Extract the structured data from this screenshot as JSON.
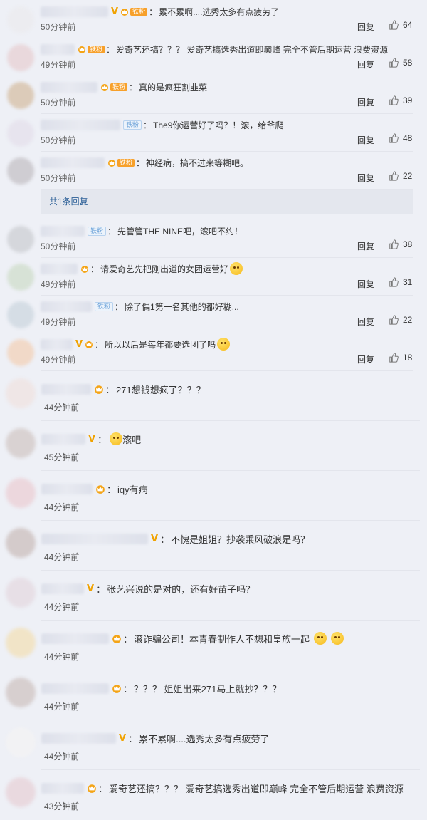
{
  "comments": [
    {
      "badge": "v",
      "fan": "orange",
      "fan_label": "铁粉",
      "text": "累不累啊....选秀太多有点疲劳了",
      "time": "50分钟前",
      "reply": "回复",
      "likes": "64",
      "avatar": "#ececf0",
      "emoji": 0
    },
    {
      "badge": "",
      "fan": "orange",
      "fan_label": "铁粉",
      "text": "爱奇艺还搞？？？ 爱奇艺搞选秀出道即巅峰 完全不管后期运营 浪费资源",
      "time": "49分钟前",
      "reply": "回复",
      "likes": "58",
      "avatar": "#e9d8dc",
      "emoji": 0
    },
    {
      "badge": "",
      "fan": "orange",
      "fan_label": "铁粉",
      "text": "真的是疯狂割韭菜",
      "time": "50分钟前",
      "reply": "回复",
      "likes": "39",
      "avatar": "#dccbb9",
      "emoji": 0
    },
    {
      "badge": "",
      "fan": "blue",
      "fan_label": "铁粉",
      "text": "The9你运营好了吗？！滚，给爷爬",
      "time": "50分钟前",
      "reply": "回复",
      "likes": "48",
      "avatar": "#e7e4ee",
      "emoji": 0
    },
    {
      "badge": "",
      "fan": "orange",
      "fan_label": "铁粉",
      "text": "神经病，搞不过来等糊吧。",
      "time": "50分钟前",
      "reply": "回复",
      "likes": "22",
      "avatar": "#cfcdd2",
      "emoji": 0
    },
    {
      "badge": "",
      "fan": "blue",
      "fan_label": "铁粉",
      "text": "先管管THE NINE吧，滚吧不约！",
      "time": "50分钟前",
      "reply": "回复",
      "likes": "38",
      "avatar": "#d5d7dc",
      "emoji": 0
    },
    {
      "badge": "",
      "fan": "crown",
      "fan_label": "",
      "text": "请爱奇艺先把刚出道的女团运营好",
      "time": "49分钟前",
      "reply": "回复",
      "likes": "31",
      "avatar": "#d7e2d6",
      "emoji": 1
    },
    {
      "badge": "",
      "fan": "blue",
      "fan_label": "铁粉",
      "text": "除了偶1第一名其他的都好糊...",
      "time": "49分钟前",
      "reply": "回复",
      "likes": "22",
      "avatar": "#d5dde5",
      "emoji": 0
    },
    {
      "badge": "v",
      "fan": "crown",
      "fan_label": "",
      "text": "所以以后是每年都要选团了吗",
      "time": "49分钟前",
      "reply": "回复",
      "likes": "18",
      "avatar": "#f1d9c8",
      "emoji": 1
    }
  ],
  "more_replies": "共1条回复",
  "large_comments": [
    {
      "badge": "",
      "text": "271想钱想疯了？？？",
      "time": "44分钟前",
      "avatar": "#efe6e6",
      "emoji": 0,
      "emoji_before": 0
    },
    {
      "badge": "v",
      "text": "滚吧",
      "time": "45分钟前",
      "avatar": "#d9d2d2",
      "emoji": 0,
      "emoji_before": 1
    },
    {
      "badge": "",
      "text": "iqy有病",
      "time": "44分钟前",
      "avatar": "#ecd7dd",
      "emoji": 0,
      "emoji_before": 0
    },
    {
      "badge": "v",
      "text": "不愧是姐姐？抄袭乘风破浪是吗？",
      "time": "44分钟前",
      "avatar": "#d4cbcb",
      "emoji": 0,
      "emoji_before": 0
    },
    {
      "badge": "v",
      "text": "张艺兴说的是对的，还有好苗子吗？",
      "time": "44分钟前",
      "avatar": "#e7dfe6",
      "emoji": 0,
      "emoji_before": 0
    },
    {
      "badge": "",
      "text": "滚诈骗公司！本青春制作人不想和皇族一起",
      "time": "44分钟前",
      "avatar": "#f1e4c7",
      "emoji": 2,
      "emoji_before": 0
    },
    {
      "badge": "",
      "text": "？？？ 姐姐出来271马上就抄？？？",
      "time": "44分钟前",
      "avatar": "#d7cfcf",
      "emoji": 0,
      "emoji_before": 0
    },
    {
      "badge": "v",
      "text": "累不累啊....选秀太多有点疲劳了",
      "time": "44分钟前",
      "avatar": "#f2f2f4",
      "emoji": 0,
      "emoji_before": 0
    },
    {
      "badge": "",
      "text": "爱奇艺还搞？？？ 爱奇艺搞选秀出道即巅峰 完全不管后期运营 浪费资源",
      "time": "43分钟前",
      "avatar": "#e9d9df",
      "emoji": 0,
      "emoji_before": 0
    }
  ],
  "icons": {
    "like": "thumbs-up-icon",
    "vip": "v-badge-icon",
    "member": "crown-icon"
  }
}
